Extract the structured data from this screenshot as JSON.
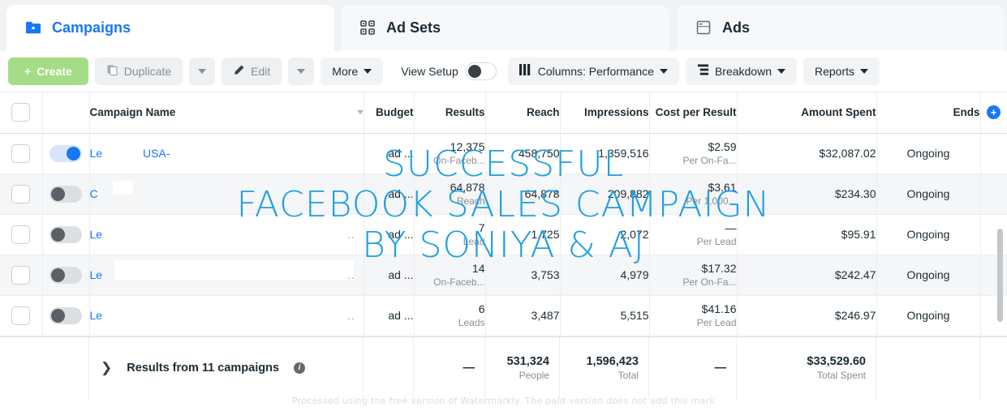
{
  "tabs": [
    {
      "label": "Campaigns",
      "icon": "campaigns-folder-icon",
      "active": true
    },
    {
      "label": "Ad Sets",
      "icon": "adsets-grid-icon",
      "active": false
    },
    {
      "label": "Ads",
      "icon": "ads-window-icon",
      "active": false
    }
  ],
  "toolbar": {
    "create": "Create",
    "duplicate": "Duplicate",
    "edit": "Edit",
    "more": "More",
    "view_setup": "View Setup",
    "view_setup_on": false,
    "columns": "Columns: Performance",
    "breakdown": "Breakdown",
    "reports": "Reports"
  },
  "table": {
    "headers": {
      "campaign_name": "Campaign Name",
      "budget": "Budget",
      "results": "Results",
      "reach": "Reach",
      "impressions": "Impressions",
      "cost_per_result": "Cost per Result",
      "amount_spent": "Amount Spent",
      "ends": "Ends",
      "add_column": "+"
    },
    "rows": [
      {
        "toggle_on": true,
        "name_prefix": "Le",
        "name_fragment": "USA-",
        "budget": "ad ...",
        "results": "12,375",
        "results_sub": "On-Faceb...",
        "reach": "458,750",
        "impressions": "1,359,516",
        "cost_per_result": "$2.59",
        "cost_per_result_sub": "Per On-Fa...",
        "amount_spent": "$32,087.02",
        "ends": "Ongoing"
      },
      {
        "toggle_on": false,
        "name_prefix": "C",
        "name_fragment": "",
        "budget": "ad ...",
        "results": "64,878",
        "results_sub": "Reach",
        "reach": "64,878",
        "impressions": "209,882",
        "cost_per_result": "$3.61",
        "cost_per_result_sub": "Per 1,000...",
        "amount_spent": "$234.30",
        "ends": "Ongoing"
      },
      {
        "toggle_on": false,
        "name_prefix": "Le",
        "name_fragment": "",
        "budget": "ad ...",
        "results": "7",
        "results_sub": "Lead",
        "reach": "1,725",
        "impressions": "2,072",
        "cost_per_result": "—",
        "cost_per_result_sub": "Per Lead",
        "amount_spent": "$95.91",
        "ends": "Ongoing"
      },
      {
        "toggle_on": false,
        "name_prefix": "Le",
        "name_fragment": "",
        "budget": "ad ...",
        "results": "14",
        "results_sub": "On-Faceb...",
        "reach": "3,753",
        "impressions": "4,979",
        "cost_per_result": "$17.32",
        "cost_per_result_sub": "Per On-Fa...",
        "amount_spent": "$242.47",
        "ends": "Ongoing"
      },
      {
        "toggle_on": false,
        "name_prefix": "Le",
        "name_fragment": "",
        "budget": "ad ...",
        "results": "6",
        "results_sub": "Leads",
        "reach": "3,487",
        "impressions": "5,515",
        "cost_per_result": "$41.16",
        "cost_per_result_sub": "Per Lead",
        "amount_spent": "$246.97",
        "ends": "Ongoing"
      }
    ],
    "summary": {
      "label": "Results from 11 campaigns",
      "budget": "",
      "results": "—",
      "reach": "531,324",
      "reach_sub": "People",
      "impressions": "1,596,423",
      "impressions_sub": "Total",
      "cost_per_result": "—",
      "amount_spent": "$33,529.60",
      "amount_spent_sub": "Total Spent"
    }
  },
  "watermark": {
    "overlay": "SUCCESSFUL\nFACEBOOK SALES CAMPAIGN\nBY SONIYA & AJ",
    "overlay_color": "#1f9fe0",
    "footer": "Processed using the free version of Watermarkly. The paid version does not add this mark"
  }
}
